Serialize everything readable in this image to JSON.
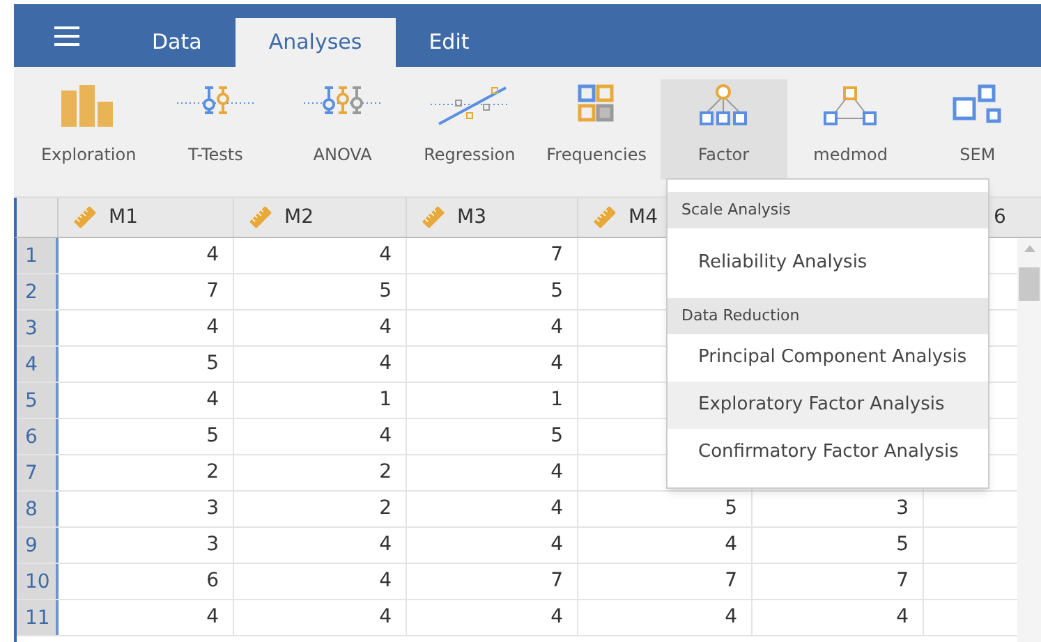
{
  "tabs": [
    {
      "label": "Data",
      "selected": false
    },
    {
      "label": "Analyses",
      "selected": true
    },
    {
      "label": "Edit",
      "selected": false
    }
  ],
  "toolbar": [
    {
      "kind": "exploration",
      "label": "Exploration",
      "selected": false
    },
    {
      "kind": "ttests",
      "label": "T-Tests",
      "selected": false
    },
    {
      "kind": "anova",
      "label": "ANOVA",
      "selected": false
    },
    {
      "kind": "regression",
      "label": "Regression",
      "selected": false
    },
    {
      "kind": "frequencies",
      "label": "Frequencies",
      "selected": false
    },
    {
      "kind": "factor",
      "label": "Factor",
      "selected": true
    },
    {
      "kind": "medmod",
      "label": "medmod",
      "selected": false
    },
    {
      "kind": "sem",
      "label": "SEM",
      "selected": false
    }
  ],
  "columns": [
    {
      "label": "M1"
    },
    {
      "label": "M2"
    },
    {
      "label": "M3"
    },
    {
      "label": "M4"
    }
  ],
  "column_6_label": "6",
  "rows": [
    {
      "number": "1",
      "cells": [
        "4",
        "4",
        "7"
      ]
    },
    {
      "number": "2",
      "cells": [
        "7",
        "5",
        "5"
      ]
    },
    {
      "number": "3",
      "cells": [
        "4",
        "4",
        "4"
      ]
    },
    {
      "number": "4",
      "cells": [
        "5",
        "4",
        "4"
      ]
    },
    {
      "number": "5",
      "cells": [
        "4",
        "1",
        "1"
      ]
    },
    {
      "number": "6",
      "cells": [
        "5",
        "4",
        "5"
      ]
    },
    {
      "number": "7",
      "cells": [
        "2",
        "2",
        "4"
      ]
    },
    {
      "number": "8",
      "cells": [
        "3",
        "2",
        "4",
        "5",
        "3"
      ]
    },
    {
      "number": "9",
      "cells": [
        "3",
        "4",
        "4",
        "4",
        "5"
      ]
    },
    {
      "number": "10",
      "cells": [
        "6",
        "4",
        "7",
        "7",
        "7"
      ]
    },
    {
      "number": "11",
      "cells": [
        "4",
        "4",
        "4",
        "4",
        "4"
      ]
    }
  ],
  "menu": {
    "items": [
      {
        "kind": "heading",
        "label": "Scale Analysis"
      },
      {
        "kind": "item",
        "label": "Reliability Analysis",
        "highlighted": false
      },
      {
        "kind": "heading",
        "label": "Data Reduction"
      },
      {
        "kind": "item",
        "label": "Principal Component Analysis",
        "highlighted": false
      },
      {
        "kind": "item",
        "label": "Exploratory Factor Analysis",
        "highlighted": true
      },
      {
        "kind": "item",
        "label": "Confirmatory Factor Analysis",
        "highlighted": false
      }
    ]
  }
}
